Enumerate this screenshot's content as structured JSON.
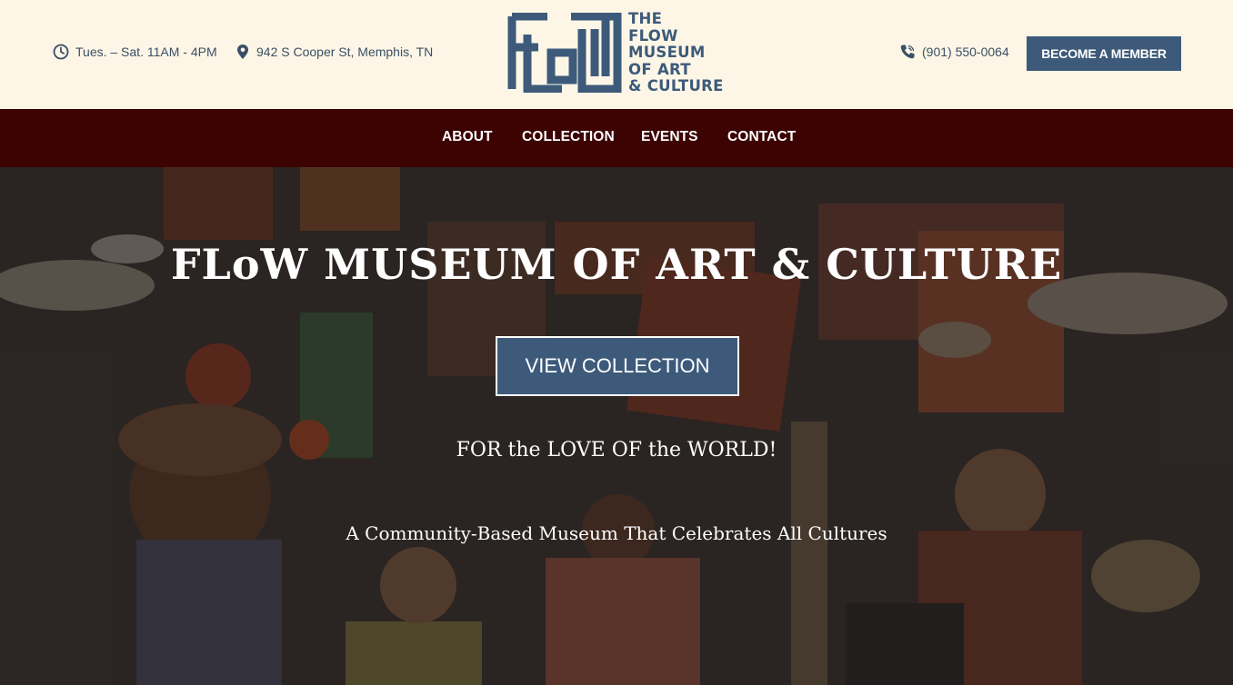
{
  "header": {
    "hours": "Tues. – Sat. 11AM - 4PM",
    "address": "942 S Cooper St, Memphis, TN",
    "phone": "(901) 550-0064",
    "member_button": "BECOME A MEMBER",
    "logo": {
      "line1": "THE",
      "line2": "FLOW",
      "line3": "MUSEUM",
      "line4": "OF ART",
      "line5": "& CULTURE"
    },
    "icons": {
      "hours": "clock-icon",
      "address": "map-pin-icon",
      "phone": "phone-icon"
    }
  },
  "nav": {
    "items": [
      {
        "label": "ABOUT"
      },
      {
        "label": "COLLECTION"
      },
      {
        "label": "EVENTS"
      },
      {
        "label": "CONTACT"
      }
    ]
  },
  "hero": {
    "title": "FLoW MUSEUM OF ART & CULTURE",
    "button": "VIEW COLLECTION",
    "tagline": "FOR the LOVE OF the WORLD!",
    "subtitle": "A Community-Based Museum That Celebrates All Cultures"
  },
  "colors": {
    "header_bg": "#fdf6e6",
    "brand_blue": "#3d5a7a",
    "nav_bg": "#3d0303",
    "text_dark": "#3b4f66"
  }
}
